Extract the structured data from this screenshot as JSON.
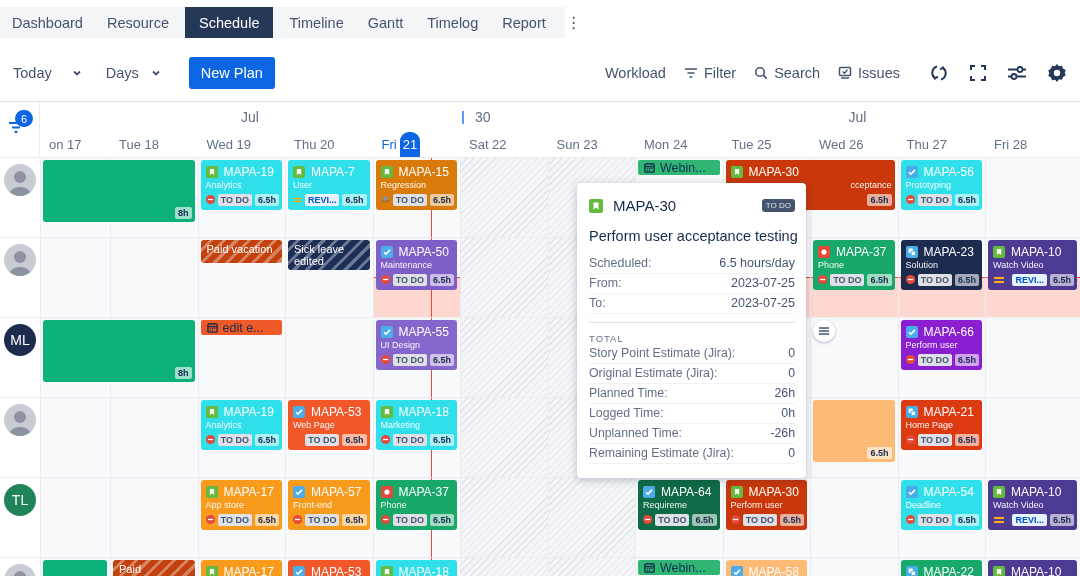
{
  "tabs": [
    {
      "label": "Dashboard",
      "selected": false
    },
    {
      "label": "Resource",
      "selected": false
    },
    {
      "label": "Schedule",
      "selected": true
    },
    {
      "label": "Timeline",
      "selected": false
    },
    {
      "label": "Gantt",
      "selected": false
    },
    {
      "label": "Timelog",
      "selected": false
    },
    {
      "label": "Report",
      "selected": false
    }
  ],
  "more_button": "⋮",
  "toolbar": {
    "today": "Today",
    "view": "Days",
    "new_plan": "New Plan",
    "actions": [
      {
        "label": "Workload",
        "kind": "text"
      },
      {
        "label": "Filter",
        "kind": "filter"
      },
      {
        "label": "Search",
        "kind": "search"
      },
      {
        "label": "Issues",
        "kind": "issues"
      }
    ],
    "icon_buttons": [
      {
        "kind": "refresh"
      },
      {
        "kind": "fullscreen"
      },
      {
        "kind": "sliders"
      },
      {
        "kind": "settings"
      }
    ]
  },
  "filter_count": "6",
  "months": [
    {
      "text": "Jul",
      "kind": "month"
    },
    {
      "text": "30",
      "kind": "week"
    },
    {
      "text": "Jul",
      "kind": "month"
    }
  ],
  "days": [
    {
      "name": "on",
      "num": "17",
      "today": false,
      "weekend": false
    },
    {
      "name": "Tue",
      "num": "18",
      "today": false,
      "weekend": false
    },
    {
      "name": "Wed",
      "num": "19",
      "today": false,
      "weekend": false
    },
    {
      "name": "Thu",
      "num": "20",
      "today": false,
      "weekend": false
    },
    {
      "name": "Fri",
      "num": "21",
      "today": true,
      "weekend": false
    },
    {
      "name": "Sat",
      "num": "22",
      "today": false,
      "weekend": true
    },
    {
      "name": "Sun",
      "num": "23",
      "today": false,
      "weekend": true
    },
    {
      "name": "Mon",
      "num": "24",
      "today": false,
      "weekend": false
    },
    {
      "name": "Tue",
      "num": "25",
      "today": false,
      "weekend": false
    },
    {
      "name": "Wed",
      "num": "26",
      "today": false,
      "weekend": false
    },
    {
      "name": "Thu",
      "num": "27",
      "today": false,
      "weekend": false
    },
    {
      "name": "Fri",
      "num": "28",
      "today": false,
      "weekend": false
    }
  ],
  "rows": [
    {
      "avatar": {
        "kind": "photo"
      },
      "overloaded": false,
      "items": [
        {
          "kind": "plan",
          "hours": "8h",
          "color": "#0bb07b"
        },
        {
          "kind": "issue",
          "key": "MAPA-19",
          "title": "Analytics",
          "icon": {
            "kind": "story"
          },
          "priority": {
            "kind": "blocker"
          },
          "status": {
            "text": "TO DO",
            "kind": "todo"
          },
          "hours": "6.5h",
          "color": "#2fdfea"
        },
        {
          "kind": "issue",
          "key": "MAPA-7",
          "title": "User",
          "icon": {
            "kind": "story"
          },
          "priority": {
            "kind": "medium"
          },
          "status": {
            "text": "REVI...",
            "kind": "review"
          },
          "hours": "6.5h",
          "color": "#2fdfea"
        },
        {
          "kind": "issue",
          "key": "MAPA-15",
          "title": "Regression",
          "icon": {
            "kind": "story"
          },
          "priority": {
            "kind": "lowest"
          },
          "status": {
            "text": "TO DO",
            "kind": "todo"
          },
          "hours": "6.5h",
          "color": "#d97b0a"
        },
        {
          "kind": "event",
          "text": "Webin...",
          "color": "#2fb574"
        },
        {
          "kind": "issue",
          "key": "MAPA-30",
          "title": "cceptance",
          "icon": {
            "kind": "story"
          },
          "hours": "6.5h",
          "color": "#c9370b"
        },
        {
          "kind": "issue",
          "key": "MAPA-56",
          "title": "Prototyping",
          "icon": {
            "kind": "task"
          },
          "priority": {
            "kind": "blocker"
          },
          "status": {
            "text": "TO DO",
            "kind": "todo"
          },
          "hours": "6.5h",
          "color": "#2fdfea"
        }
      ]
    },
    {
      "avatar": {
        "kind": "photo"
      },
      "overloaded": true,
      "items": [
        {
          "kind": "leave",
          "text": "Paid vacation",
          "color": "#c2410c"
        },
        {
          "kind": "leave",
          "text": "Sick leave edited",
          "color": "#1e2f57"
        },
        {
          "kind": "issue",
          "key": "MAPA-50",
          "title": "Maintenance",
          "icon": {
            "kind": "task"
          },
          "priority": {
            "kind": "blocker"
          },
          "status": {
            "text": "TO DO",
            "kind": "todo"
          },
          "hours": "6.5h",
          "color": "#7e5fc7"
        },
        {
          "kind": "issue",
          "key": "MAPA-37",
          "title": "Phone",
          "icon": {
            "kind": "bug"
          },
          "priority": {
            "kind": "blocker"
          },
          "status": {
            "text": "TO DO",
            "kind": "todo"
          },
          "hours": "6.5h",
          "color": "#17a86a"
        },
        {
          "kind": "issue",
          "key": "MAPA-23",
          "title": "Solution",
          "icon": {
            "kind": "subtask"
          },
          "priority": {
            "kind": "blocker"
          },
          "status": {
            "text": "TO DO",
            "kind": "todo"
          },
          "hours": "6.5h",
          "color": "#1d2b4f"
        },
        {
          "kind": "issue",
          "key": "MAPA-10",
          "title": "Watch Video",
          "icon": {
            "kind": "story"
          },
          "priority": {
            "kind": "medium"
          },
          "status": {
            "text": "REVI...",
            "kind": "review"
          },
          "hours": "6.5h",
          "color": "#4d3a92"
        }
      ]
    },
    {
      "avatar": {
        "kind": "initials",
        "initials": "ML",
        "color": "#1d2b4f"
      },
      "overloaded": false,
      "items": [
        {
          "kind": "plan",
          "hours": "8h",
          "color": "#0bb07b"
        },
        {
          "kind": "event",
          "text": "edit e...",
          "color": "#f05a28"
        },
        {
          "kind": "issue",
          "key": "MAPA-55",
          "title": "UI Design",
          "icon": {
            "kind": "task"
          },
          "priority": {
            "kind": "blocker"
          },
          "status": {
            "text": "TO DO",
            "kind": "todo"
          },
          "hours": "6.5h",
          "color": "#8466cc"
        },
        {
          "kind": "menu"
        },
        {
          "kind": "issue",
          "key": "MAPA-66",
          "title": "Perform user",
          "icon": {
            "kind": "task"
          },
          "priority": {
            "kind": "blocker"
          },
          "status": {
            "text": "TO DO",
            "kind": "todo"
          },
          "hours": "6.5h",
          "color": "#8a1fd1"
        }
      ]
    },
    {
      "avatar": {
        "kind": "photo"
      },
      "overloaded": false,
      "items": [
        {
          "kind": "issue",
          "key": "MAPA-19",
          "title": "Analytics",
          "icon": {
            "kind": "story"
          },
          "priority": {
            "kind": "blocker"
          },
          "status": {
            "text": "TO DO",
            "kind": "todo"
          },
          "hours": "6.5h",
          "color": "#2fdfea"
        },
        {
          "kind": "issue",
          "key": "MAPA-53",
          "title": "Web Page",
          "icon": {
            "kind": "task"
          },
          "status": {
            "text": "TO DO",
            "kind": "todo"
          },
          "hours": "6.5h",
          "color": "#f2572a"
        },
        {
          "kind": "issue",
          "key": "MAPA-18",
          "title": "Marketing",
          "icon": {
            "kind": "story"
          },
          "priority": {
            "kind": "blocker"
          },
          "status": {
            "text": "TO DO",
            "kind": "todo"
          },
          "hours": "6.5h",
          "color": "#2fdfea"
        },
        {
          "kind": "plan",
          "hours": "6.5h",
          "color": "#fdba74"
        },
        {
          "kind": "issue",
          "key": "MAPA-21",
          "title": "Home Page",
          "icon": {
            "kind": "subtask"
          },
          "priority": {
            "kind": "blocker"
          },
          "status": {
            "text": "TO DO",
            "kind": "todo"
          },
          "hours": "6.5h",
          "color": "#dd3a12"
        }
      ]
    },
    {
      "avatar": {
        "kind": "initials",
        "initials": "TL",
        "color": "#1f845a"
      },
      "overloaded": false,
      "items": [
        {
          "kind": "issue",
          "key": "MAPA-17",
          "title": "App store",
          "icon": {
            "kind": "story"
          },
          "priority": {
            "kind": "blocker"
          },
          "status": {
            "text": "TO DO",
            "kind": "todo"
          },
          "hours": "6.5h",
          "color": "#f89a1c"
        },
        {
          "kind": "issue",
          "key": "MAPA-57",
          "title": "Front-end",
          "icon": {
            "kind": "task"
          },
          "priority": {
            "kind": "blocker"
          },
          "status": {
            "text": "TO DO",
            "kind": "todo"
          },
          "hours": "6.5h",
          "color": "#f89a1c"
        },
        {
          "kind": "issue",
          "key": "MAPA-37",
          "title": "Phone",
          "icon": {
            "kind": "bug"
          },
          "priority": {
            "kind": "blocker"
          },
          "status": {
            "text": "TO DO",
            "kind": "todo"
          },
          "hours": "6.5h",
          "color": "#17a86a"
        },
        {
          "kind": "issue",
          "key": "MAPA-64",
          "title": "Requireme",
          "icon": {
            "kind": "task"
          },
          "priority": {
            "kind": "blocker"
          },
          "status": {
            "text": "TO DO",
            "kind": "todo"
          },
          "hours": "6.5h",
          "color": "#0e6b46"
        },
        {
          "kind": "issue",
          "key": "MAPA-30",
          "title": "Perform user",
          "icon": {
            "kind": "story"
          },
          "priority": {
            "kind": "blocker"
          },
          "status": {
            "text": "TO DO",
            "kind": "todo"
          },
          "hours": "6.5h",
          "color": "#c9370b"
        },
        {
          "kind": "issue",
          "key": "MAPA-54",
          "title": "Deadline",
          "icon": {
            "kind": "task"
          },
          "priority": {
            "kind": "blocker"
          },
          "status": {
            "text": "TO DO",
            "kind": "todo"
          },
          "hours": "6.5h",
          "color": "#2fdfea"
        },
        {
          "kind": "issue",
          "key": "MAPA-10",
          "title": "Watch Video",
          "icon": {
            "kind": "story"
          },
          "priority": {
            "kind": "medium"
          },
          "status": {
            "text": "REVI...",
            "kind": "review"
          },
          "hours": "6.5h",
          "color": "#4d3a92"
        }
      ]
    },
    {
      "avatar": {
        "kind": "photo"
      },
      "overloaded": false,
      "items": [
        {
          "kind": "plan",
          "color": "#0bb07b"
        },
        {
          "kind": "leave",
          "text": "Paid",
          "color": "#c2410c"
        },
        {
          "kind": "issue",
          "key": "MAPA-17",
          "icon": {
            "kind": "story"
          },
          "color": "#f89a1c"
        },
        {
          "kind": "issue",
          "key": "MAPA-53",
          "icon": {
            "kind": "task"
          },
          "color": "#f2572a"
        },
        {
          "kind": "issue",
          "key": "MAPA-18",
          "icon": {
            "kind": "story"
          },
          "color": "#2fdfea"
        },
        {
          "kind": "event",
          "text": "Webin...",
          "color": "#2fb574"
        },
        {
          "kind": "issue",
          "key": "MAPA-58",
          "icon": {
            "kind": "task"
          },
          "color": "#fdba74"
        },
        {
          "kind": "issue",
          "key": "MAPA-22",
          "icon": {
            "kind": "subtask"
          },
          "color": "#17a86a"
        },
        {
          "kind": "issue",
          "key": "MAPA-10",
          "icon": {
            "kind": "story"
          },
          "color": "#4d3a92"
        }
      ]
    }
  ],
  "tooltip": {
    "key": "MAPA-30",
    "icon": {
      "kind": "story"
    },
    "status": "TO DO",
    "title": "Perform user acceptance testing",
    "details": [
      {
        "label": "Scheduled:",
        "value": "6.5 hours/day"
      },
      {
        "label": "From:",
        "value": "2023-07-25"
      },
      {
        "label": "To:",
        "value": "2023-07-25"
      }
    ],
    "section": "TOTAL",
    "totals": [
      {
        "label": "Story Point Estimate (Jira):",
        "value": "0"
      },
      {
        "label": "Original Estimate (Jira):",
        "value": "0"
      },
      {
        "label": "Planned Time:",
        "value": "26h"
      },
      {
        "label": "Logged Time:",
        "value": "0h"
      },
      {
        "label": "Unplanned Time:",
        "value": "-26h"
      },
      {
        "label": "Remaining Estimate (Jira):",
        "value": "0"
      }
    ]
  }
}
